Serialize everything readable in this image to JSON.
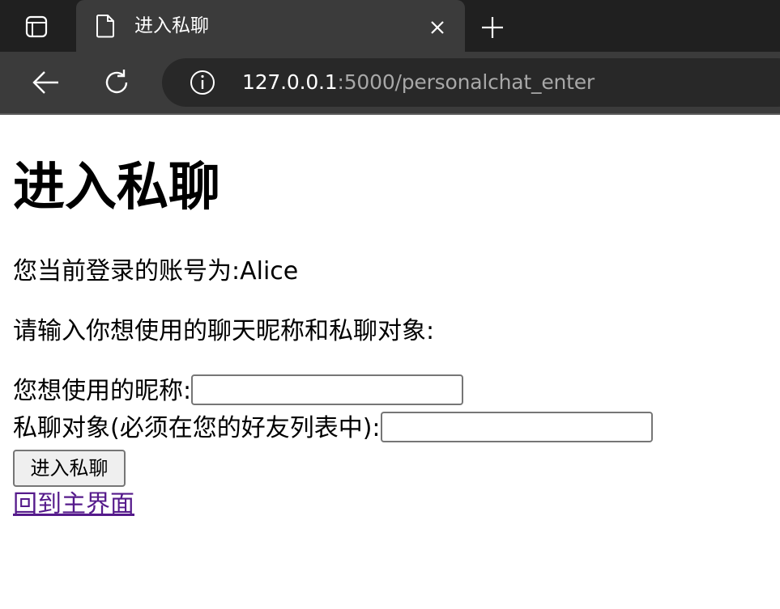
{
  "browser": {
    "tab": {
      "title": "进入私聊"
    },
    "address": {
      "host": "127.0.0.1",
      "rest": ":5000/personalchat_enter"
    },
    "icons": {
      "tab_actions": "tab-actions-icon",
      "page": "page-icon",
      "close": "close-icon",
      "new_tab": "plus-icon",
      "back": "back-arrow-icon",
      "reload": "reload-icon",
      "site_info": "info-icon"
    },
    "colors": {
      "tabstrip": "#202020",
      "toolbar": "#3b3b3b",
      "address_bar": "#282828"
    }
  },
  "page": {
    "heading": "进入私聊",
    "current_user": "您当前登录的账号为:Alice",
    "prompt": "请输入你想使用的聊天昵称和私聊对象:",
    "form": {
      "nickname_label": "您想使用的昵称:",
      "nickname_value": "",
      "target_label": "私聊对象(必须在您的好友列表中):",
      "target_value": "",
      "submit_label": "进入私聊"
    },
    "home_link": "回到主界面",
    "colors": {
      "visited_link": "#551a8b"
    }
  }
}
